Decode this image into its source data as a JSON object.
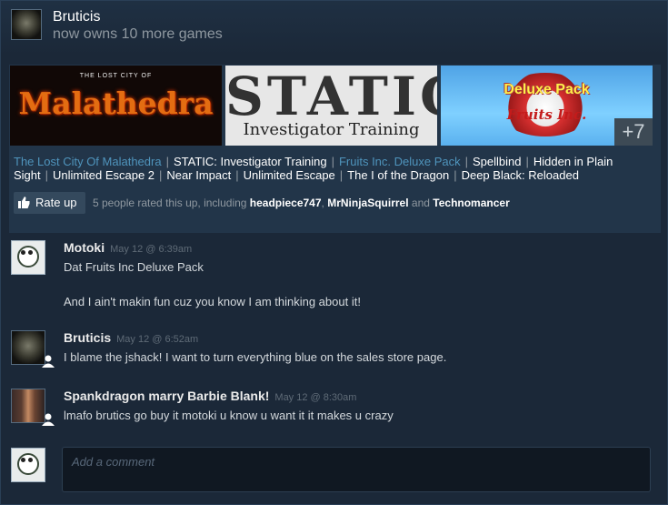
{
  "activity": {
    "user": "Bruticis",
    "action": "now owns 10 more games"
  },
  "capsules": [
    {
      "top_text": "THE LOST CITY OF",
      "title": "Malathedra"
    },
    {
      "title": "STATIC",
      "subtitle": "Investigator Training"
    },
    {
      "title": "Deluxe Pack",
      "subtitle": "Fruits Inc."
    }
  ],
  "more_count": "+7",
  "games": [
    {
      "name": "The Lost City Of Malathedra",
      "highlight": true
    },
    {
      "name": "STATIC: Investigator Training",
      "highlight": false
    },
    {
      "name": "Fruits Inc. Deluxe Pack",
      "highlight": true
    },
    {
      "name": "Spellbind",
      "highlight": false
    },
    {
      "name": "Hidden in Plain Sight",
      "highlight": false
    },
    {
      "name": "Unlimited Escape 2",
      "highlight": false
    },
    {
      "name": "Near Impact",
      "highlight": false
    },
    {
      "name": "Unlimited Escape",
      "highlight": false
    },
    {
      "name": "The I of the Dragon",
      "highlight": false
    },
    {
      "name": "Deep Black: Reloaded",
      "highlight": false
    }
  ],
  "rate": {
    "button_label": "Rate up",
    "text_prefix": "5 people rated this up, including",
    "user1": "headpiece747",
    "user2": "MrNinjaSquirrel",
    "and_word": "and",
    "user3": "Technomancer"
  },
  "comments": [
    {
      "author": "Motoki",
      "time": "May 12 @ 6:39am",
      "lines": [
        "Dat Fruits Inc Deluxe Pack",
        "And I ain't makin fun cuz you know I am thinking about it!"
      ]
    },
    {
      "author": "Bruticis",
      "time": "May 12 @ 6:52am",
      "lines": [
        "I blame the jshack! I want to turn everything blue on the sales store page."
      ]
    },
    {
      "author": "Spankdragon marry Barbie Blank!",
      "time": "May 12 @ 8:30am",
      "lines": [
        "lmafo brutics go buy it motoki u know u want it it makes u crazy"
      ]
    }
  ],
  "composer": {
    "placeholder": "Add a comment"
  },
  "colors": {
    "background": "#1b2838",
    "highlight_link": "#4f94bc",
    "muted": "#8f98a0"
  }
}
